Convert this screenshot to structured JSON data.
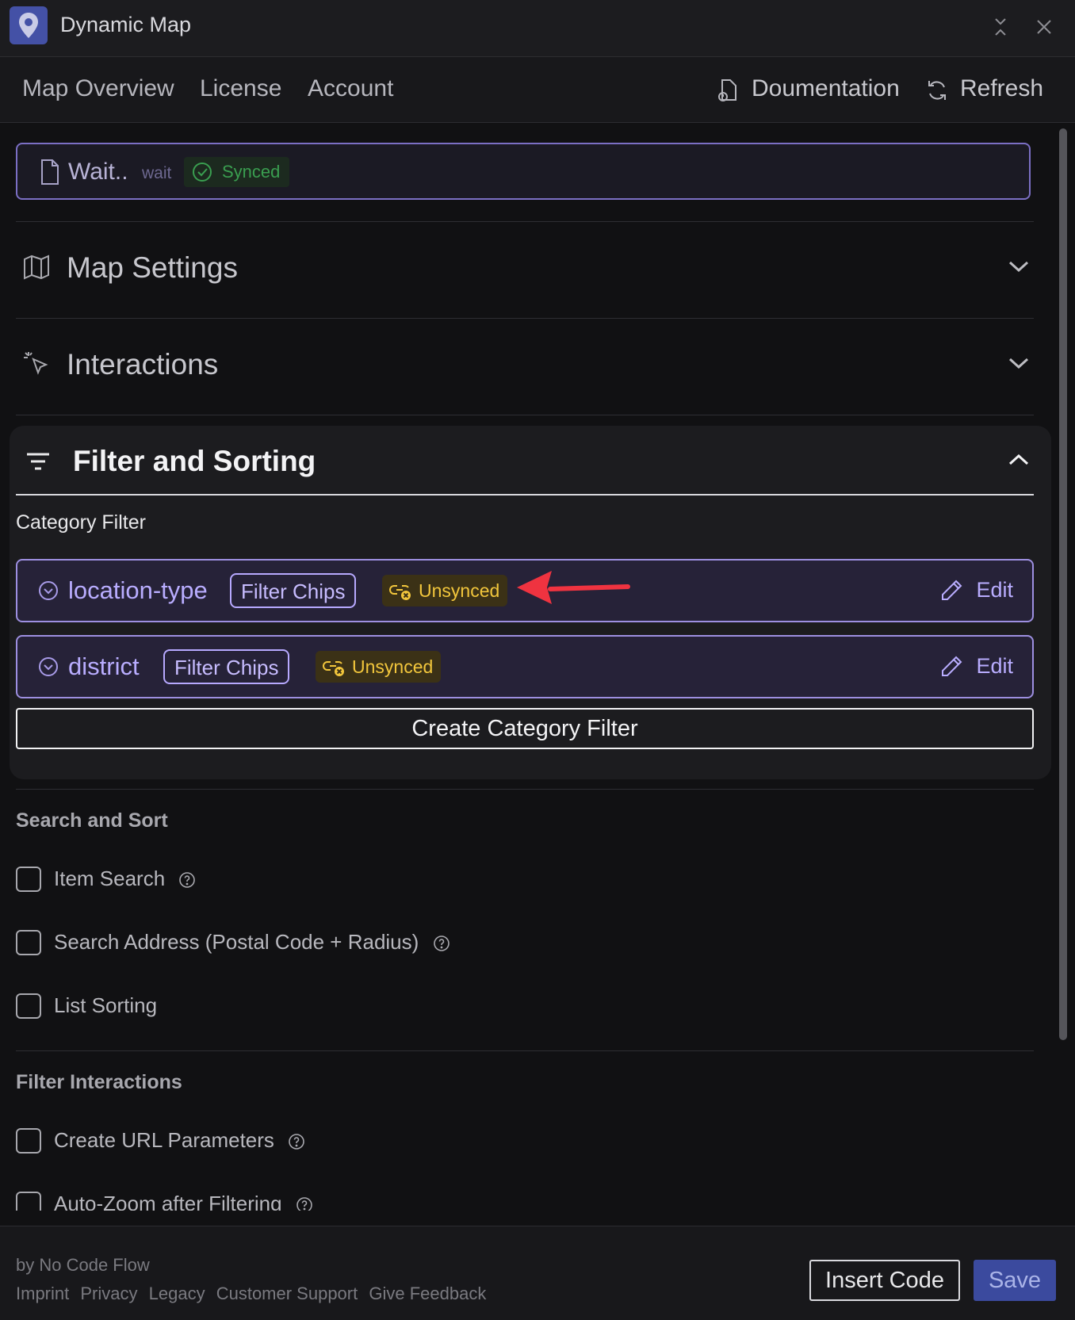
{
  "window": {
    "title": "Dynamic Map",
    "app_icon": "map-pin-icon",
    "controls": [
      "collapse-icon",
      "close-icon"
    ]
  },
  "nav": {
    "tabs": [
      {
        "label": "Map Overview"
      },
      {
        "label": "License"
      },
      {
        "label": "Account"
      }
    ],
    "documentation": "Doumentation",
    "refresh": "Refresh"
  },
  "file": {
    "title": "Wait..",
    "subtitle": "wait",
    "status": "Synced",
    "status_color": "#3a9e50"
  },
  "sections": {
    "map_settings": "Map Settings",
    "interactions": "Interactions",
    "filter_sorting": "Filter and Sorting"
  },
  "filter": {
    "category_label": "Category Filter",
    "items": [
      {
        "name": "location-type",
        "chip": "Filter Chips",
        "status": "Unsynced",
        "edit": "Edit"
      },
      {
        "name": "district",
        "chip": "Filter Chips",
        "status": "Unsynced",
        "edit": "Edit"
      }
    ],
    "create_button": "Create Category Filter",
    "accent_color": "#b9adff",
    "unsynced_color": "#f2c63c"
  },
  "search_sort": {
    "heading": "Search and Sort",
    "options": [
      {
        "label": "Item Search",
        "checked": false
      },
      {
        "label": "Search Address (Postal Code + Radius)",
        "checked": false
      },
      {
        "label": "List Sorting",
        "checked": false
      }
    ]
  },
  "filter_interactions": {
    "heading": "Filter Interactions",
    "options": [
      {
        "label": "Create URL Parameters",
        "checked": false
      },
      {
        "label": "Auto-Zoom after Filtering",
        "checked": false
      }
    ]
  },
  "footer": {
    "by": "by No Code Flow",
    "links": [
      "Imprint",
      "Privacy",
      "Legacy",
      "Customer Support",
      "Give Feedback"
    ],
    "insert_code": "Insert Code",
    "save": "Save",
    "save_color": "#3b4a9e"
  }
}
